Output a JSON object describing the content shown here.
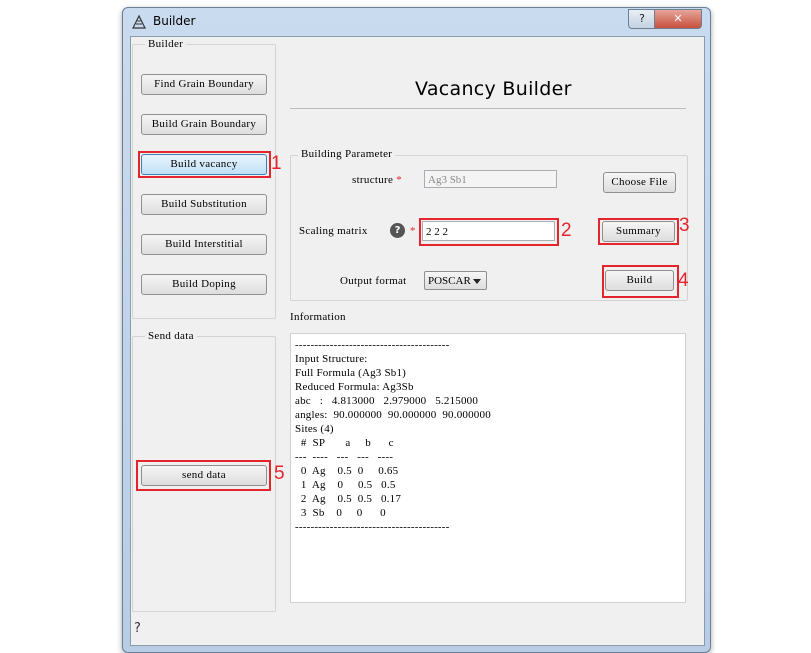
{
  "window": {
    "title": "Builder",
    "help_glyph": "?",
    "close_glyph": "✕"
  },
  "sidebar": {
    "group_title": "Builder",
    "buttons": [
      "Find Grain Boundary",
      "Build Grain Boundary",
      "Build vacancy",
      "Build Substitution",
      "Build Interstitial",
      "Build Doping"
    ],
    "send_group_title": "Send data",
    "send_button": "send data"
  },
  "main": {
    "heading": "Vacancy Builder",
    "param_group_title": "Building Parameter",
    "structure_label": "structure",
    "structure_value": "Ag3 Sb1",
    "choose_file": "Choose File",
    "scaling_label": "Scaling matrix",
    "scaling_value": "2 2 2",
    "summary": "Summary",
    "output_label": "Output format",
    "output_value": "POSCAR",
    "build": "Build",
    "required_mark": "*",
    "help_glyph": "?",
    "info_label": "Information",
    "info_text": "----------------------------------------\nInput Structure:\nFull Formula (Ag3 Sb1)\nReduced Formula: Ag3Sb\nabc   :   4.813000   2.979000   5.215000\nangles:  90.000000  90.000000  90.000000\nSites (4)\n  #  SP       a     b      c\n---  ----   ---   ---   ----\n  0  Ag    0.5  0     0.65\n  1  Ag    0     0.5   0.5\n  2  Ag    0.5  0.5   0.17\n  3  Sb    0     0      0\n----------------------------------------"
  },
  "annotations": [
    "1",
    "2",
    "3",
    "4",
    "5"
  ],
  "status": {
    "help_glyph": "?"
  },
  "colors": {
    "annotation_red": "#e4252c",
    "title_bar": "#c0d4ea",
    "selected_button": "#bfe0f7"
  }
}
